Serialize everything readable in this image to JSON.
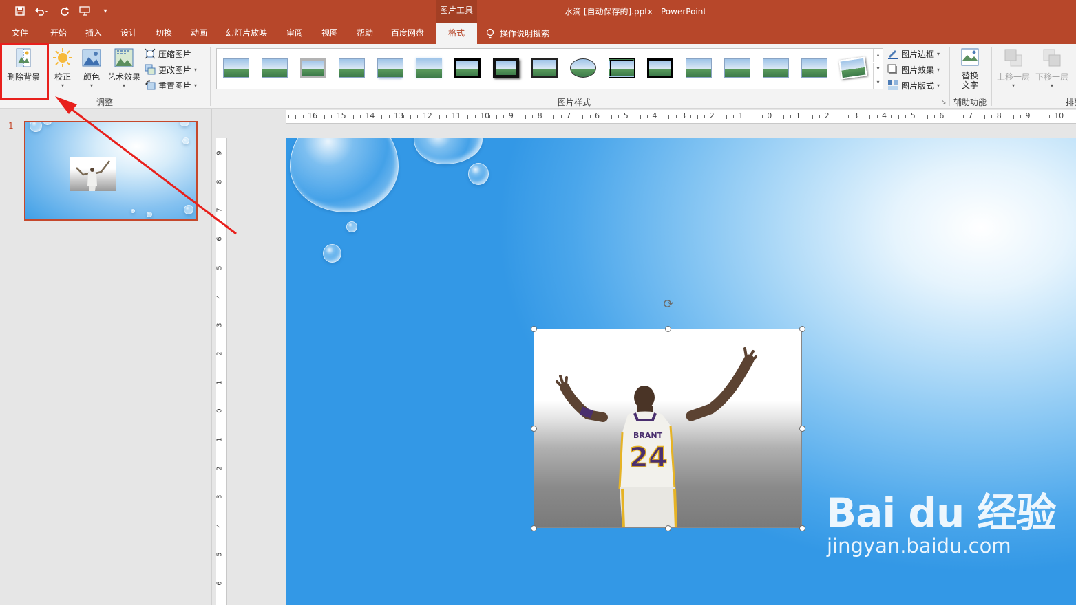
{
  "titlebar": {
    "quick_access": [
      "save-icon",
      "undo-icon",
      "redo-icon",
      "present-icon",
      "customize-icon"
    ],
    "context_group": "图片工具",
    "document_title": "水滴 [自动保存的].pptx  -  PowerPoint"
  },
  "tabs": [
    "文件",
    "开始",
    "插入",
    "设计",
    "切换",
    "动画",
    "幻灯片放映",
    "审阅",
    "视图",
    "帮助",
    "百度网盘",
    "格式"
  ],
  "active_tab": "格式",
  "tell_me": "操作说明搜索",
  "ribbon": {
    "remove_background": "删除背景",
    "adjust": {
      "corrections": "校正",
      "color": "颜色",
      "artistic_effects": "艺术效果",
      "compress": "压缩图片",
      "change_picture": "更改图片",
      "reset_picture": "重置图片",
      "label": "调整"
    },
    "styles": {
      "label": "图片样式",
      "border": "图片边框",
      "effects": "图片效果",
      "layout": "图片版式",
      "gallery_count": 17
    },
    "accessibility": {
      "alt_text_line1": "替换",
      "alt_text_line2": "文字",
      "label": "辅助功能"
    },
    "arrange": {
      "bring_forward": "上移一层",
      "send_backward": "下移一层",
      "label": "排列"
    }
  },
  "ruler": {
    "horizontal": [
      "16",
      "15",
      "14",
      "13",
      "12",
      "11",
      "10",
      "9",
      "8",
      "7",
      "6",
      "5",
      "4",
      "3",
      "2",
      "1",
      "0",
      "1",
      "2",
      "3",
      "4",
      "5",
      "6",
      "7",
      "8",
      "9",
      "10"
    ],
    "vertical": [
      "9",
      "8",
      "7",
      "6",
      "5",
      "4",
      "3",
      "2",
      "1",
      "0",
      "1",
      "2",
      "3",
      "4",
      "5",
      "6"
    ]
  },
  "thumbnail": {
    "number": "1"
  },
  "picture": {
    "jersey_name": "BRANT",
    "jersey_number": "24"
  },
  "watermark": {
    "logo": "Bai du 经验",
    "url": "jingyan.baidu.com"
  },
  "colors": {
    "accent": "#b7472a",
    "highlight": "#e8201c"
  }
}
